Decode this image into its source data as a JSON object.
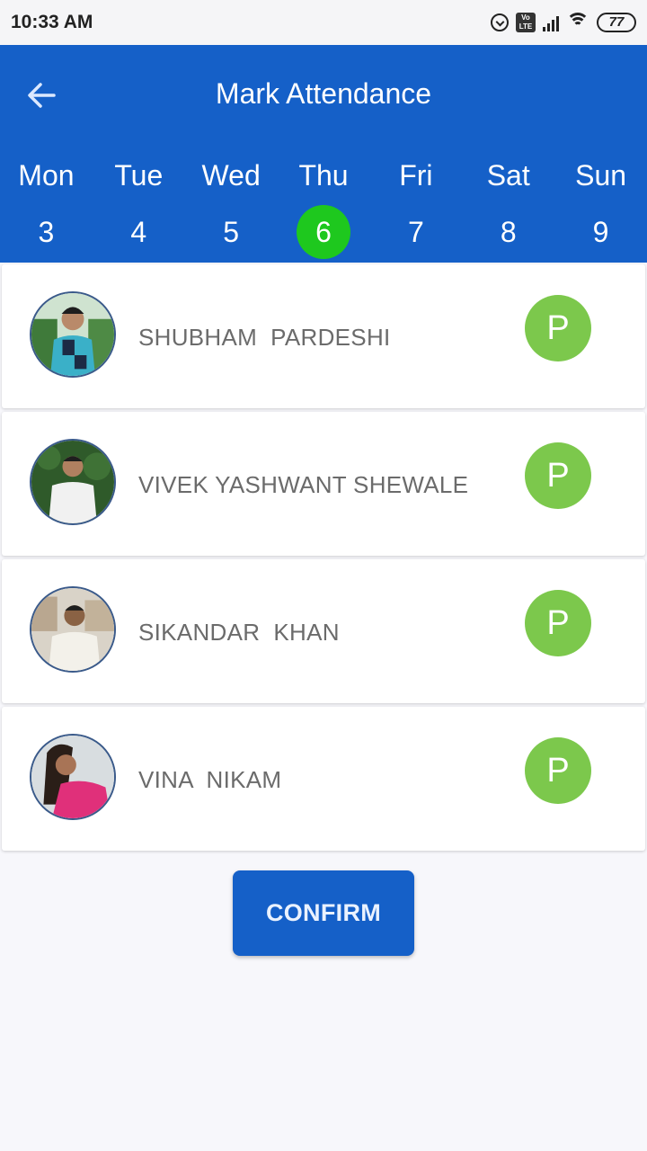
{
  "status_bar": {
    "time": "10:33 AM",
    "icons": [
      "alarm-icon",
      "volte-icon",
      "signal-icon",
      "wifi-icon",
      "battery-icon"
    ],
    "volte_label": "Vo LTE",
    "battery_level": "77"
  },
  "header": {
    "back_icon": "arrow-left-icon",
    "title": "Mark Attendance"
  },
  "week": {
    "days": [
      {
        "name": "Mon",
        "date": "3",
        "selected": false
      },
      {
        "name": "Tue",
        "date": "4",
        "selected": false
      },
      {
        "name": "Wed",
        "date": "5",
        "selected": false
      },
      {
        "name": "Thu",
        "date": "6",
        "selected": true
      },
      {
        "name": "Fri",
        "date": "7",
        "selected": false
      },
      {
        "name": "Sat",
        "date": "8",
        "selected": false
      },
      {
        "name": "Sun",
        "date": "9",
        "selected": false
      }
    ]
  },
  "students": [
    {
      "name": "SHUBHAM  PARDESHI",
      "status": "P"
    },
    {
      "name": "VIVEK YASHWANT SHEWALE",
      "status": "P"
    },
    {
      "name": "SIKANDAR  KHAN",
      "status": "P"
    },
    {
      "name": "VINA  NIKAM",
      "status": "P"
    }
  ],
  "actions": {
    "confirm_label": "CONFIRM"
  },
  "colors": {
    "primary": "#1560c8",
    "selected_day": "#1ec81e",
    "present": "#7cc84c"
  }
}
